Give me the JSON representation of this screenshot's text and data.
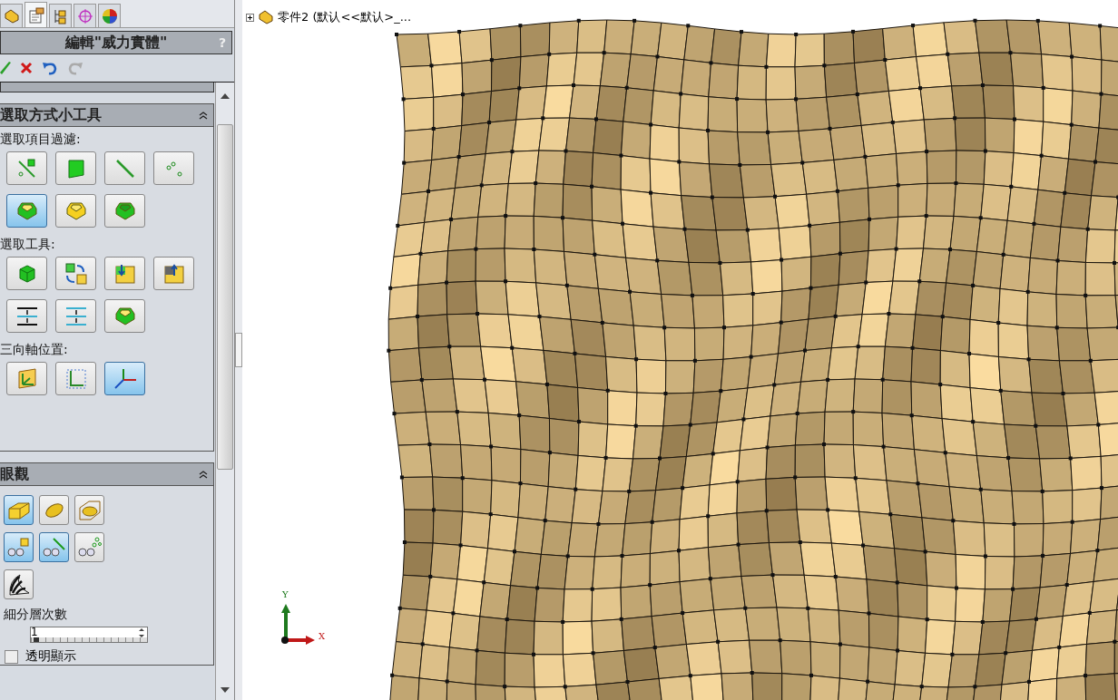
{
  "tabs": [
    {
      "kind": "part",
      "selected": false
    },
    {
      "kind": "property",
      "selected": true
    },
    {
      "kind": "config",
      "selected": false
    },
    {
      "kind": "target",
      "selected": false
    },
    {
      "kind": "display",
      "selected": false
    }
  ],
  "panel": {
    "title": "編輯\"威力實體\"",
    "help": "?"
  },
  "sections": [
    {
      "title": "選取方式小工具",
      "expanded": true,
      "groups": [
        {
          "label": "選取項目過濾:",
          "rows": [
            [
              {
                "kind": "edge-vertex",
                "selected": false
              },
              {
                "kind": "face",
                "selected": false
              },
              {
                "kind": "edge",
                "selected": false
              },
              {
                "kind": "vertices",
                "selected": false
              }
            ],
            [
              {
                "kind": "body-yellow-green",
                "selected": true
              },
              {
                "kind": "body-yellow",
                "selected": false
              },
              {
                "kind": "body-green",
                "selected": false
              }
            ]
          ]
        },
        {
          "label": "選取工具:",
          "rows": [
            [
              {
                "kind": "cube",
                "selected": false
              },
              {
                "kind": "swap-grid",
                "selected": false
              },
              {
                "kind": "grid-down",
                "selected": false
              },
              {
                "kind": "grid-up",
                "selected": false
              }
            ],
            [
              {
                "kind": "lines-out",
                "selected": false
              },
              {
                "kind": "lines-in",
                "selected": false
              },
              {
                "kind": "open-body",
                "selected": false
              }
            ]
          ]
        },
        {
          "label": "三向軸位置:",
          "rows": [
            [
              {
                "kind": "plane-axes",
                "selected": false
              },
              {
                "kind": "dashed-axes",
                "selected": false
              },
              {
                "kind": "triad",
                "selected": true
              }
            ]
          ]
        }
      ]
    }
  ],
  "appearance": {
    "title": "眼觀",
    "expanded": true,
    "rows": [
      [
        {
          "kind": "shaded-box",
          "selected": true
        },
        {
          "kind": "ellipsoid",
          "selected": false
        },
        {
          "kind": "box-wire",
          "selected": false
        }
      ],
      [
        {
          "kind": "glasses-face",
          "selected": true
        },
        {
          "kind": "glasses-edge",
          "selected": true
        },
        {
          "kind": "glasses-points",
          "selected": false
        }
      ],
      [
        {
          "kind": "zebra",
          "selected": false
        }
      ]
    ],
    "subdivision": {
      "label": "細分層次數",
      "value": "1",
      "level": 0.02
    },
    "transparent": {
      "label": "透明顯示",
      "checked": false
    }
  },
  "tree": {
    "label": "零件2  (默认<<默认>_...",
    "expanded": false
  },
  "triad": {
    "x": "X",
    "y": "Y"
  }
}
